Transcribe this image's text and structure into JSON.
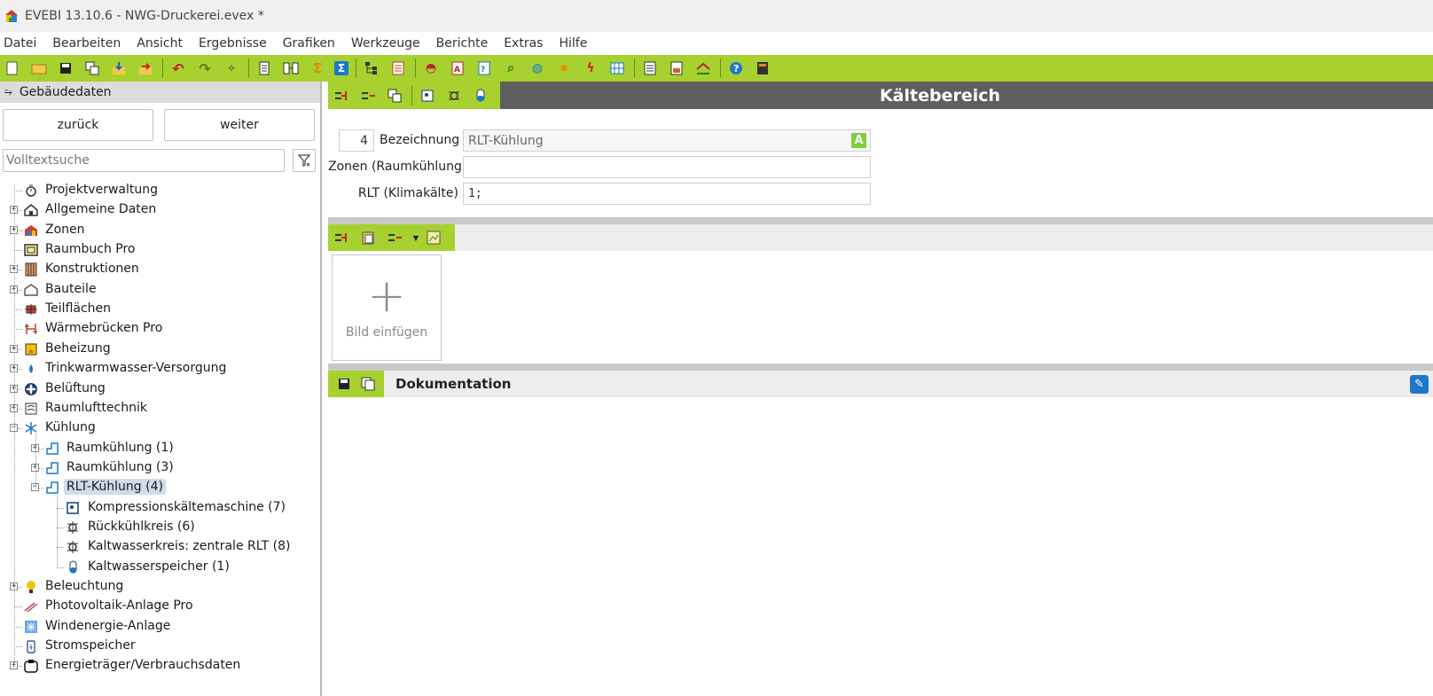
{
  "window": {
    "title": "EVEBI 13.10.6 - NWG-Druckerei.evex *"
  },
  "menu": [
    "Datei",
    "Bearbeiten",
    "Ansicht",
    "Ergebnisse",
    "Grafiken",
    "Werkzeuge",
    "Berichte",
    "Extras",
    "Hilfe"
  ],
  "toolbar": {
    "icons": [
      "new-file-icon",
      "open-folder-icon",
      "save-icon",
      "copy-icon",
      "import-icon",
      "export-icon",
      "undo-icon",
      "redo-icon",
      "magic-wand-icon",
      "document-icon",
      "structure-icon",
      "sum-icon",
      "sigma-icon",
      "tree-icon",
      "list-icon",
      "cap-icon",
      "pdf-icon",
      "checklist-icon",
      "zoom-icon",
      "globe-icon",
      "sun-icon",
      "lightning-icon",
      "grid-icon",
      "report-icon",
      "bar-chart-icon",
      "house-chart-icon",
      "help-icon",
      "calculator-icon"
    ]
  },
  "left_panel": {
    "header": "Gebäudedaten",
    "back_label": "zurück",
    "next_label": "weiter",
    "search_placeholder": "Volltextsuche",
    "tree": [
      {
        "label": "Projektverwaltung",
        "icon": "stopwatch-icon",
        "level": 0,
        "expander": "none"
      },
      {
        "label": "Allgemeine Daten",
        "icon": "house-icon",
        "level": 0,
        "expander": "plus"
      },
      {
        "label": "Zonen",
        "icon": "zones-icon",
        "level": 0,
        "expander": "plus"
      },
      {
        "label": "Raumbuch Pro",
        "icon": "roombook-icon",
        "level": 0,
        "expander": "none"
      },
      {
        "label": "Konstruktionen",
        "icon": "construction-icon",
        "level": 0,
        "expander": "plus"
      },
      {
        "label": "Bauteile",
        "icon": "building-part-icon",
        "level": 0,
        "expander": "plus"
      },
      {
        "label": "Teilflächen",
        "icon": "partial-area-icon",
        "level": 0,
        "expander": "none"
      },
      {
        "label": "Wärmebrücken Pro",
        "icon": "thermal-bridge-icon",
        "level": 0,
        "expander": "none"
      },
      {
        "label": "Beheizung",
        "icon": "heating-icon",
        "level": 0,
        "expander": "plus"
      },
      {
        "label": "Trinkwarmwasser-Versorgung",
        "icon": "water-drop-icon",
        "level": 0,
        "expander": "plus"
      },
      {
        "label": "Belüftung",
        "icon": "fan-icon",
        "level": 0,
        "expander": "plus"
      },
      {
        "label": "Raumlufttechnik",
        "icon": "hvac-icon",
        "level": 0,
        "expander": "plus"
      },
      {
        "label": "Kühlung",
        "icon": "snowflake-icon",
        "level": 0,
        "expander": "minus"
      },
      {
        "label": "Raumkühlung (1)",
        "icon": "cooling-area-icon",
        "level": 1,
        "expander": "plus"
      },
      {
        "label": "Raumkühlung (3)",
        "icon": "cooling-area-icon",
        "level": 1,
        "expander": "plus"
      },
      {
        "label": "RLT-Kühlung (4)",
        "icon": "cooling-area-icon",
        "level": 1,
        "expander": "minus",
        "selected": true
      },
      {
        "label": "Kompressionskältemaschine (7)",
        "icon": "compressor-icon",
        "level": 2,
        "expander": "none"
      },
      {
        "label": "Rückkühlkreis (6)",
        "icon": "pump-icon",
        "level": 2,
        "expander": "none"
      },
      {
        "label": "Kaltwasserkreis: zentrale RLT (8)",
        "icon": "pump-icon",
        "level": 2,
        "expander": "none"
      },
      {
        "label": "Kaltwasserspeicher (1)",
        "icon": "storage-tank-icon",
        "level": 2,
        "expander": "none"
      },
      {
        "label": "Beleuchtung",
        "icon": "lightbulb-icon",
        "level": 0,
        "expander": "plus"
      },
      {
        "label": "Photovoltaik-Anlage Pro",
        "icon": "solar-icon",
        "level": 0,
        "expander": "none"
      },
      {
        "label": "Windenergie-Anlage",
        "icon": "wind-icon",
        "level": 0,
        "expander": "none"
      },
      {
        "label": "Stromspeicher",
        "icon": "battery-icon",
        "level": 0,
        "expander": "none"
      },
      {
        "label": "Energieträger/Verbrauchsdaten",
        "icon": "energy-source-icon",
        "level": 0,
        "expander": "plus"
      }
    ]
  },
  "main": {
    "title": "Kältebereich",
    "form": {
      "number": "4",
      "bezeichnung_label": "Bezeichnung",
      "bezeichnung_value": "RLT-Kühlung",
      "bezeichnung_badge": "A",
      "zonen_label": "Zonen (Raumkühlung)",
      "zonen_value": "",
      "rlt_label": "RLT (Klimakälte)",
      "rlt_value": "1;"
    },
    "image": {
      "add_label": "Bild einfügen",
      "plus": "+"
    },
    "documentation": {
      "title": "Dokumentation"
    }
  },
  "colors": {
    "accent": "#a6d12e",
    "title_band": "#5f5f5f",
    "selection": "#cfdced"
  }
}
